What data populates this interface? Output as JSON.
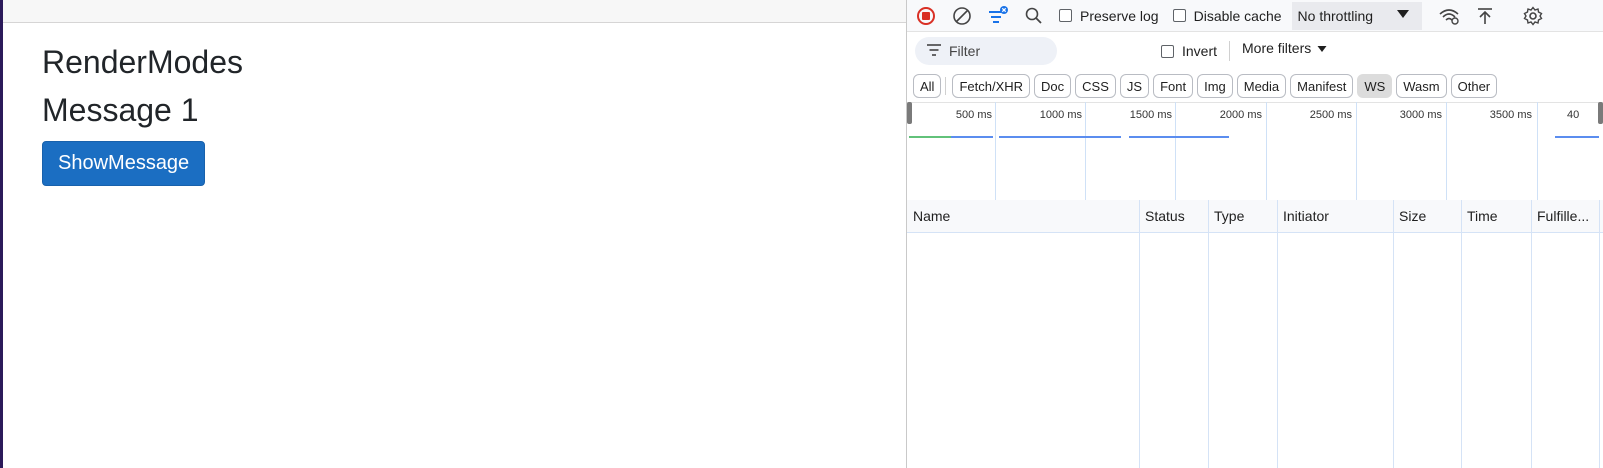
{
  "page": {
    "title": "RenderModes",
    "message": "Message 1",
    "button_label": "ShowMessage"
  },
  "devtools": {
    "toolbar": {
      "preserve_log": "Preserve log",
      "disable_cache": "Disable cache",
      "throttling": "No throttling"
    },
    "filter_bar": {
      "filter_placeholder": "Filter",
      "invert": "Invert",
      "more_filters": "More filters"
    },
    "type_filters": [
      "All",
      "Fetch/XHR",
      "Doc",
      "CSS",
      "JS",
      "Font",
      "Img",
      "Media",
      "Manifest",
      "WS",
      "Wasm",
      "Other"
    ],
    "active_type_filter": "WS",
    "timeline": {
      "tick_labels": [
        "500 ms",
        "1000 ms",
        "1500 ms",
        "2000 ms",
        "2500 ms",
        "3000 ms",
        "3500 ms",
        "40"
      ]
    },
    "table": {
      "columns": [
        "Name",
        "Status",
        "Type",
        "Initiator",
        "Size",
        "Time",
        "Fulfille..."
      ]
    },
    "colors": {
      "accent": "#1b6ec2",
      "record": "#d93025",
      "timeline_bar": "#5b8def"
    }
  }
}
